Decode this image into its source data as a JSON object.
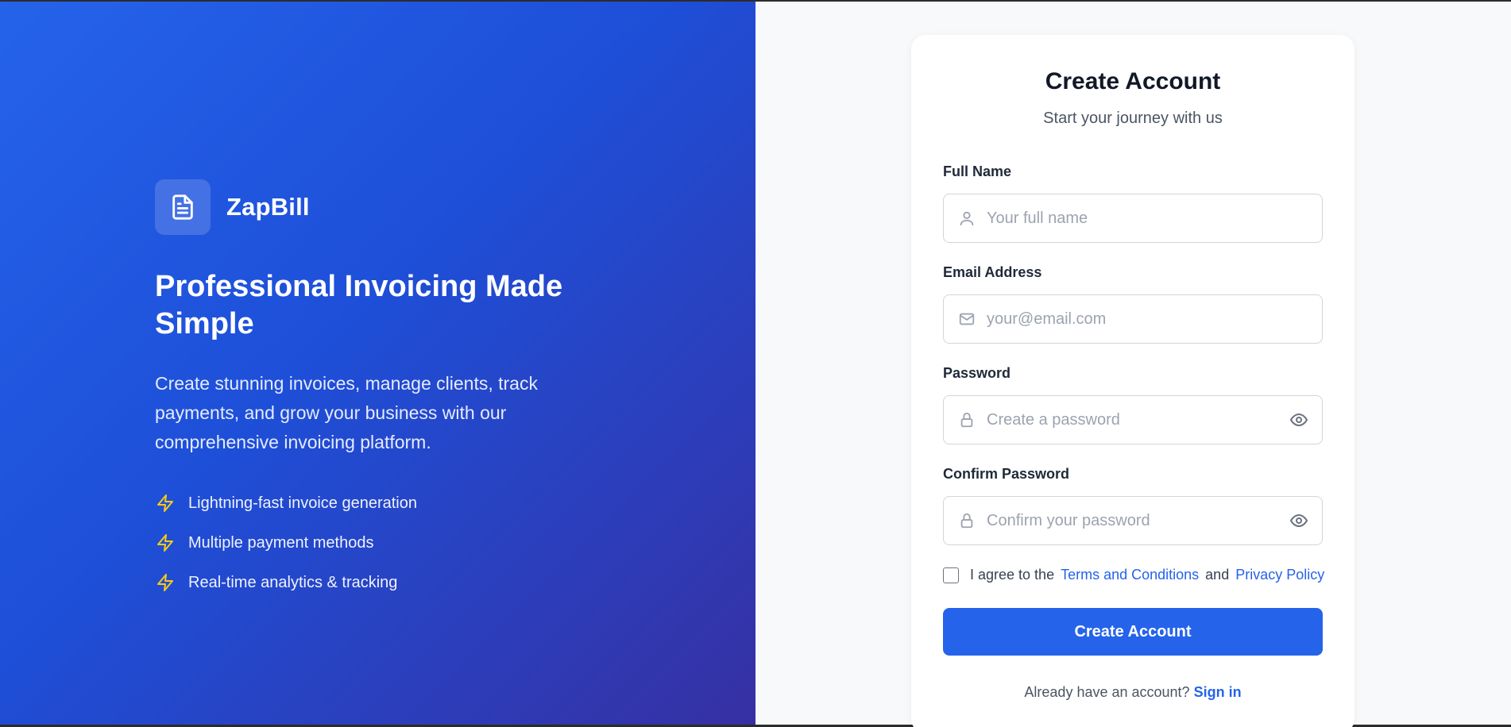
{
  "brand": {
    "name": "ZapBill",
    "logo_icon": "document-icon"
  },
  "hero": {
    "title": "Professional Invoicing Made Simple",
    "description": "Create stunning invoices, manage clients, track payments, and grow your business with our comprehensive invoicing platform.",
    "features": [
      {
        "icon": "lightning-icon",
        "label": "Lightning-fast invoice generation"
      },
      {
        "icon": "lightning-icon",
        "label": "Multiple payment methods"
      },
      {
        "icon": "lightning-icon",
        "label": "Real-time analytics & tracking"
      }
    ]
  },
  "form": {
    "title": "Create Account",
    "subtitle": "Start your journey with us",
    "full_name": {
      "label": "Full Name",
      "placeholder": "Your full name",
      "value": "",
      "icon": "user-icon"
    },
    "email": {
      "label": "Email Address",
      "placeholder": "your@email.com",
      "value": "",
      "icon": "mail-icon"
    },
    "password": {
      "label": "Password",
      "placeholder": "Create a password",
      "value": "",
      "icon": "lock-icon",
      "toggle_icon": "eye-icon"
    },
    "confirm_password": {
      "label": "Confirm Password",
      "placeholder": "Confirm your password",
      "value": "",
      "icon": "lock-icon",
      "toggle_icon": "eye-icon"
    },
    "terms": {
      "checked": false,
      "prefix": "I agree to the",
      "terms_link": "Terms and Conditions",
      "conjunction": "and",
      "privacy_link": "Privacy Policy"
    },
    "submit_label": "Create Account",
    "signin_prompt": "Already have an account?",
    "signin_link": "Sign in"
  },
  "colors": {
    "hero_gradient_start": "#2563eb",
    "hero_gradient_end": "#3730a3",
    "accent": "#2563eb",
    "feature_icon": "#facc15",
    "page_background": "#f8f9fb"
  }
}
